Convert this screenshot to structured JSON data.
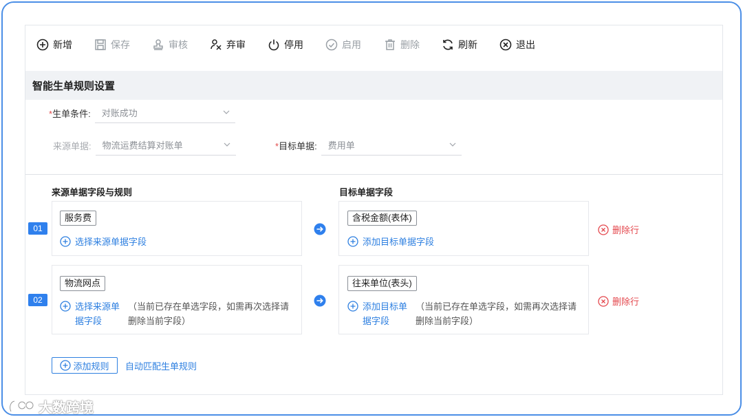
{
  "toolbar": {
    "items": [
      {
        "label": "新增",
        "icon": "plus-circle-icon",
        "disabled": false
      },
      {
        "label": "保存",
        "icon": "save-icon",
        "disabled": true
      },
      {
        "label": "审核",
        "icon": "stamp-icon",
        "disabled": true
      },
      {
        "label": "弃审",
        "icon": "user-x-icon",
        "disabled": false
      },
      {
        "label": "停用",
        "icon": "power-icon",
        "disabled": false
      },
      {
        "label": "启用",
        "icon": "check-circle-icon",
        "disabled": true
      },
      {
        "label": "删除",
        "icon": "trash-icon",
        "disabled": true
      },
      {
        "label": "刷新",
        "icon": "refresh-icon",
        "disabled": false
      },
      {
        "label": "退出",
        "icon": "close-circle-icon",
        "disabled": false
      }
    ]
  },
  "section": {
    "title": "智能生单规则设置"
  },
  "form": {
    "condition": {
      "required": "*",
      "label": "生单条件:",
      "value": "对账成功"
    },
    "source_doc": {
      "label": "来源单据:",
      "value": "物流运费结算对账单"
    },
    "target_doc": {
      "required": "*",
      "label": "目标单据:",
      "value": "费用单"
    }
  },
  "rules": {
    "source_title": "来源单据字段与规则",
    "target_title": "目标单据字段",
    "rows": [
      {
        "num": "01",
        "source_field": "服务费",
        "source_action": "选择来源单据字段",
        "source_action_line2": "",
        "source_hint": "",
        "source_hint_line2": "",
        "target_field": "含税金额(表体)",
        "target_action": "添加目标单据字段",
        "target_action_line2": "",
        "target_hint": "",
        "target_hint_line2": "",
        "delete": "删除行"
      },
      {
        "num": "02",
        "source_field": "物流网点",
        "source_action": "选择来源单",
        "source_action_line2": "据字段",
        "source_hint": "（当前已存在单选字段，如需再次选择请",
        "source_hint_line2": "删除当前字段）",
        "target_field": "往来单位(表头)",
        "target_action": "添加目标单",
        "target_action_line2": "据字段",
        "target_hint": "（当前已存在单选字段，如需再次选择请",
        "target_hint_line2": "删除当前字段）",
        "delete": "删除行"
      }
    ],
    "add_rule": "添加规则",
    "auto_match": "自动匹配生单规则"
  },
  "watermark": {
    "text": "大数跨境"
  },
  "colors": {
    "accent": "#2f80ed",
    "danger": "#e4474d",
    "frame": "#4a8ee6"
  }
}
